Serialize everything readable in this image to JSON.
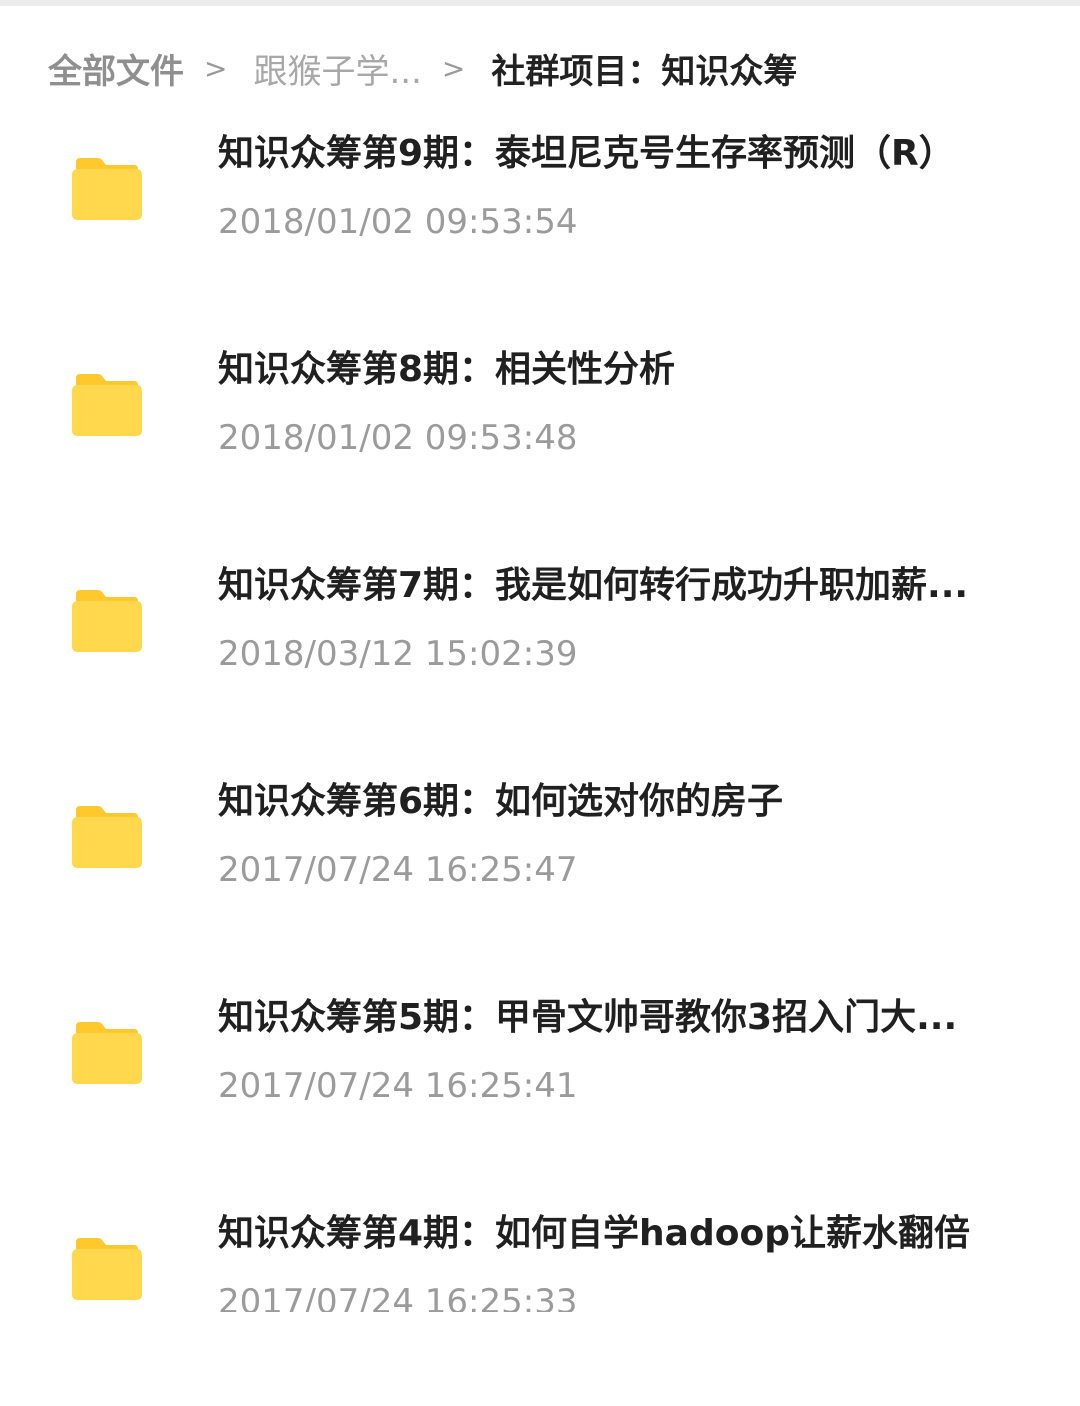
{
  "breadcrumb": {
    "root": "全部文件",
    "middle": "跟猴子学...",
    "current": "社群项目：知识众筹",
    "separator": ">"
  },
  "folder_color": "#FFD84E",
  "folder_tab_color": "#FFC92E",
  "files": [
    {
      "name": "知识众筹第9期：泰坦尼克号生存率预测（R）",
      "date": "2018/01/02 09:53:54",
      "icon": "folder-icon"
    },
    {
      "name": "知识众筹第8期：相关性分析",
      "date": "2018/01/02 09:53:48",
      "icon": "folder-icon"
    },
    {
      "name": "知识众筹第7期：我是如何转行成功升职加薪...",
      "date": "2018/03/12 15:02:39",
      "icon": "folder-icon"
    },
    {
      "name": "知识众筹第6期：如何选对你的房子",
      "date": "2017/07/24 16:25:47",
      "icon": "folder-icon"
    },
    {
      "name": "知识众筹第5期：甲骨文帅哥教你3招入门大...",
      "date": "2017/07/24 16:25:41",
      "icon": "folder-icon"
    },
    {
      "name": "知识众筹第4期：如何自学hadoop让薪水翻倍",
      "date": "2017/07/24 16:25:33",
      "icon": "folder-icon"
    }
  ]
}
